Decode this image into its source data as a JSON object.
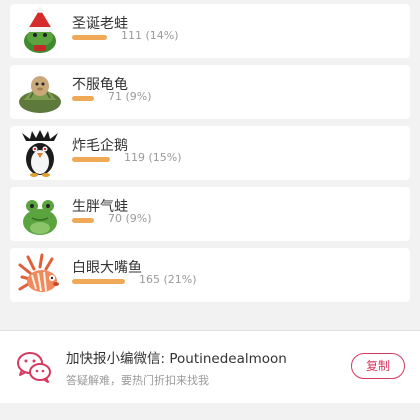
{
  "poll": {
    "options": [
      {
        "name": "圣诞老蛙",
        "count": 111,
        "percent": 14,
        "result": "111 (14%)",
        "icon": "santa-frog-plush"
      },
      {
        "name": "不服龟龟",
        "count": 71,
        "percent": 9,
        "result": "71 (9%)",
        "icon": "tortoise-plush"
      },
      {
        "name": "炸毛企鹅",
        "count": 119,
        "percent": 15,
        "result": "119 (15%)",
        "icon": "rockhopper-penguin-plush"
      },
      {
        "name": "生胖气蛙",
        "count": 70,
        "percent": 9,
        "result": "70 (9%)",
        "icon": "frog-plush"
      },
      {
        "name": "白眼大嘴鱼",
        "count": 165,
        "percent": 21,
        "result": "165 (21%)",
        "icon": "lionfish-plush"
      }
    ],
    "bar_color": "#f0a956"
  },
  "contact": {
    "title": "加快报小编微信: Poutinedealmoon",
    "subtitle": "答疑解难，要热门折扣来找我",
    "copy_label": "复制",
    "icon": "wechat-icon",
    "accent": "#d63a5e"
  }
}
